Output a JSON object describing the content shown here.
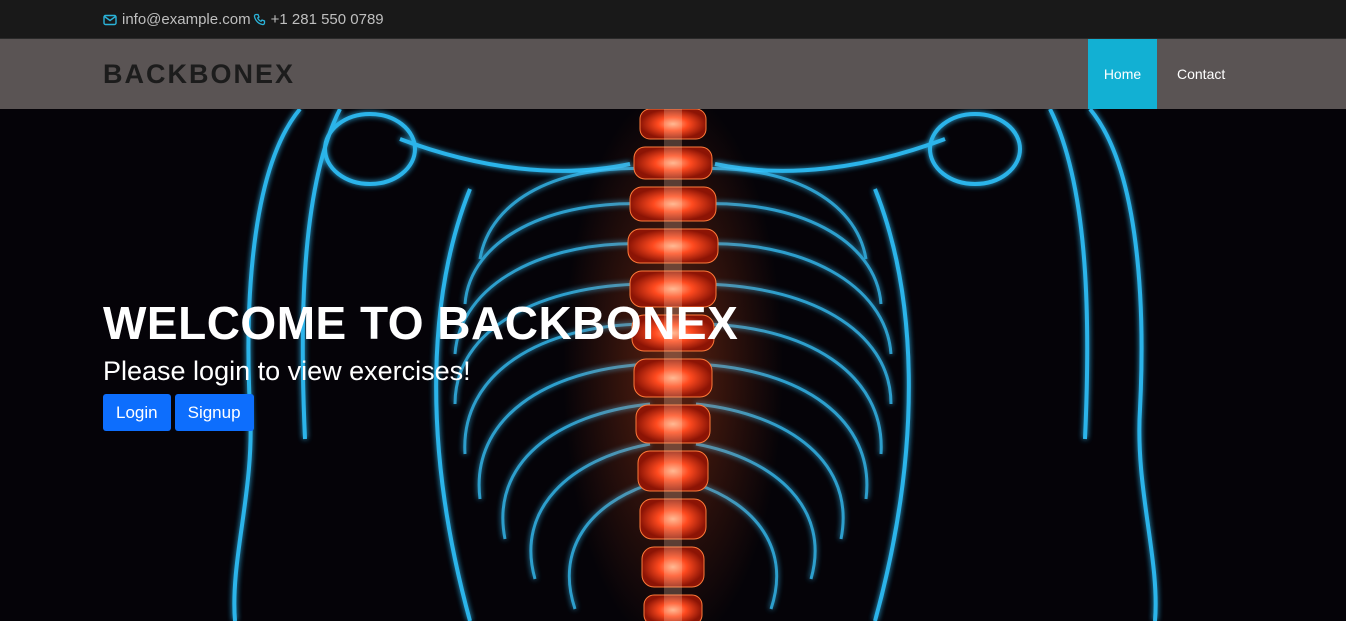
{
  "topbar": {
    "email": "info@example.com",
    "phone": "+1 281 550 0789",
    "email_icon": "envelope-icon",
    "phone_icon": "phone-icon"
  },
  "navbar": {
    "brand": "BACKBONEX",
    "links": [
      {
        "label": "Home",
        "active": true
      },
      {
        "label": "Contact",
        "active": false
      }
    ]
  },
  "hero": {
    "title": "WELCOME TO BACKBONEX",
    "subtitle": "Please login to view exercises!",
    "login_label": "Login",
    "signup_label": "Signup",
    "background": "x-ray torso with highlighted spine"
  },
  "colors": {
    "accent": "#12b0d3",
    "button": "#0d6efd",
    "navbar": "#5a5454",
    "topbar": "#191919",
    "bone": "#3fc8ff",
    "spine": "#ff4a1f"
  }
}
